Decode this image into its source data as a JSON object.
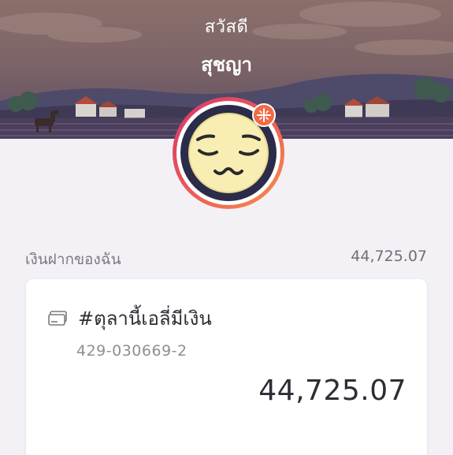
{
  "header": {
    "greeting": "สวัสดี",
    "user_name": "สุชญา"
  },
  "profile": {
    "avatar_icon": "sleepy-face-avatar",
    "badge_icon": "sparkle-badge-icon"
  },
  "deposits": {
    "label": "เงินฝากของฉัน",
    "total": "44,725.07"
  },
  "account": {
    "icon": "card-icon",
    "name": "#ตุลานี้เอลี่มีเงิน",
    "number": "429-030669-2",
    "balance": "44,725.07"
  },
  "colors": {
    "ring_start": "#d8356e",
    "ring_end": "#f5914a",
    "badge": "#f06b46",
    "page_background": "#f3f1f5"
  }
}
